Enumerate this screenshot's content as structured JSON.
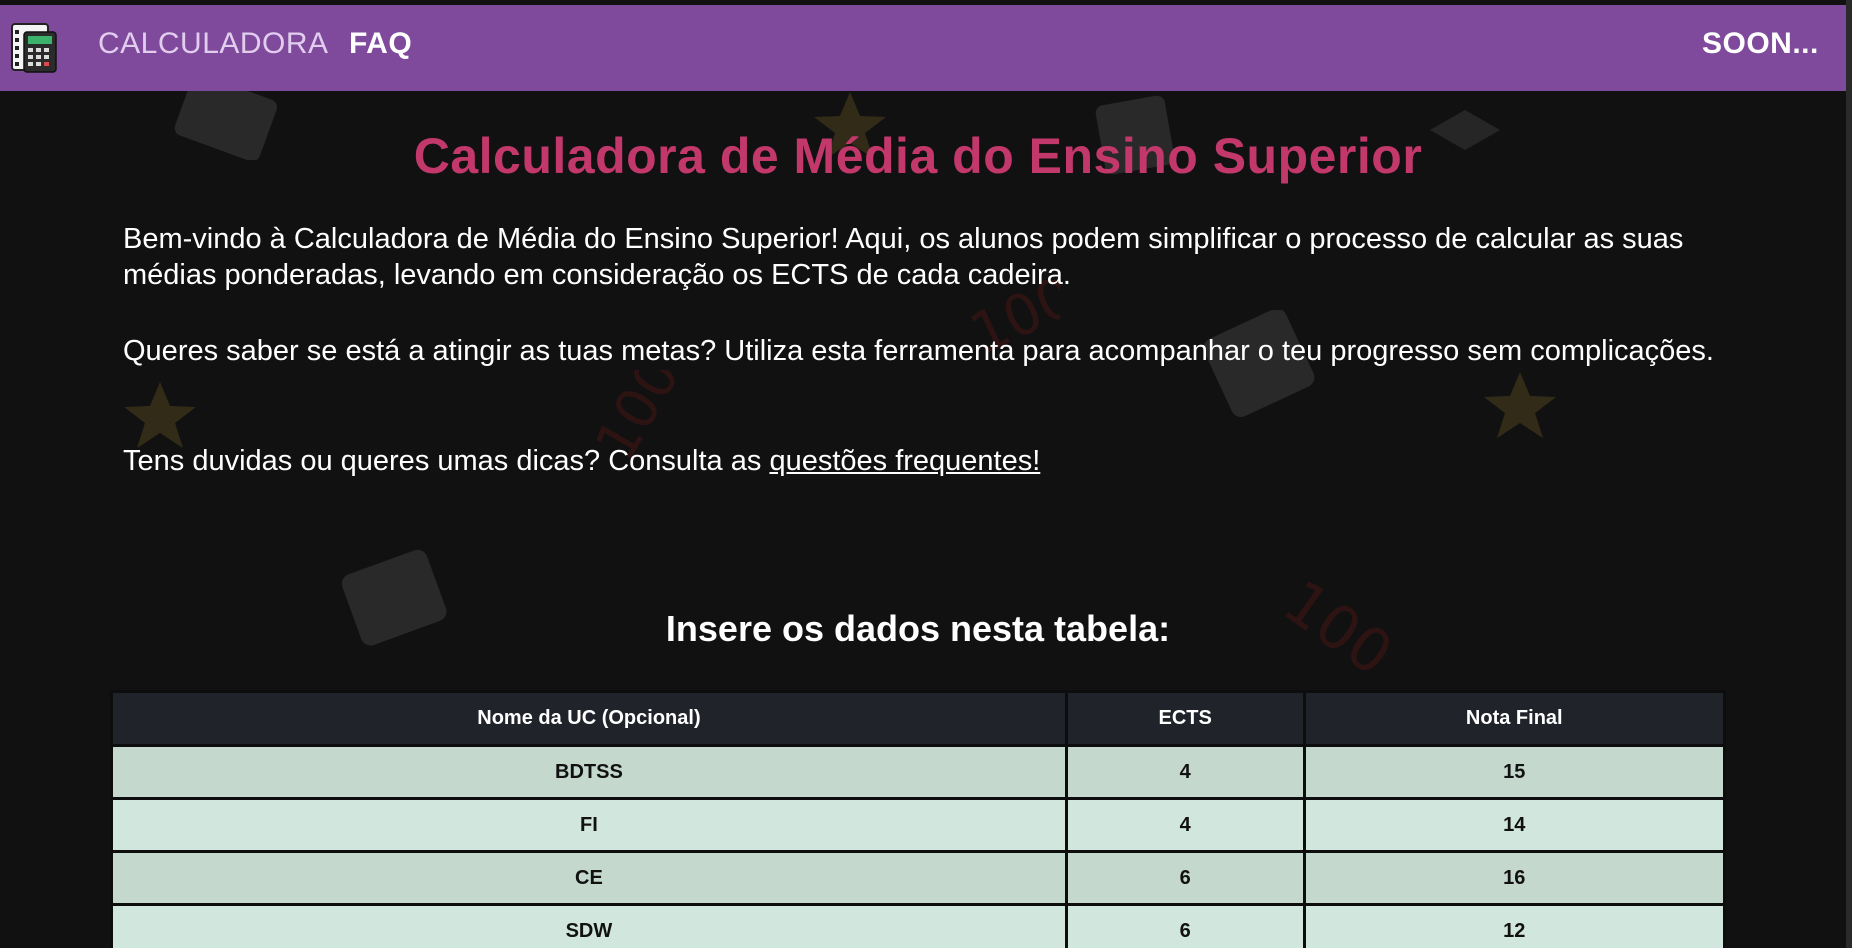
{
  "nav": {
    "logo_icon": "calculator-logo-icon",
    "items": [
      {
        "label": "CALCULADORA"
      },
      {
        "label": "FAQ"
      }
    ],
    "right_label": "SOON..."
  },
  "main": {
    "title": "Calculadora de Média do Ensino Superior",
    "paragraphs": [
      "Bem-vindo à Calculadora de Média do Ensino Superior! Aqui, os alunos podem simplificar o processo de calcular as suas médias ponderadas, levando em consideração os ECTS de cada cadeira.",
      "Queres saber se está a atingir as tuas metas? Utiliza esta ferramenta para acompanhar o teu progresso sem complicações."
    ],
    "faq_prompt": "Tens duvidas ou queres umas dicas? Consulta as ",
    "faq_link": "questões frequentes!",
    "table_heading": "Insere os dados nesta tabela:"
  },
  "table": {
    "columns": [
      "Nome da UC (Opcional)",
      "ECTS",
      "Nota Final"
    ],
    "rows": [
      [
        "BDTSS",
        "4",
        "15"
      ],
      [
        "FI",
        "4",
        "14"
      ],
      [
        "CE",
        "6",
        "16"
      ],
      [
        "SDW",
        "6",
        "12"
      ]
    ]
  },
  "colors": {
    "navbar": "#7f4a9c",
    "title": "#c2386b",
    "background": "#111111",
    "table_header": "#20232a",
    "row_light": "#d1e6dc",
    "row_dark": "#c4d8ce"
  }
}
